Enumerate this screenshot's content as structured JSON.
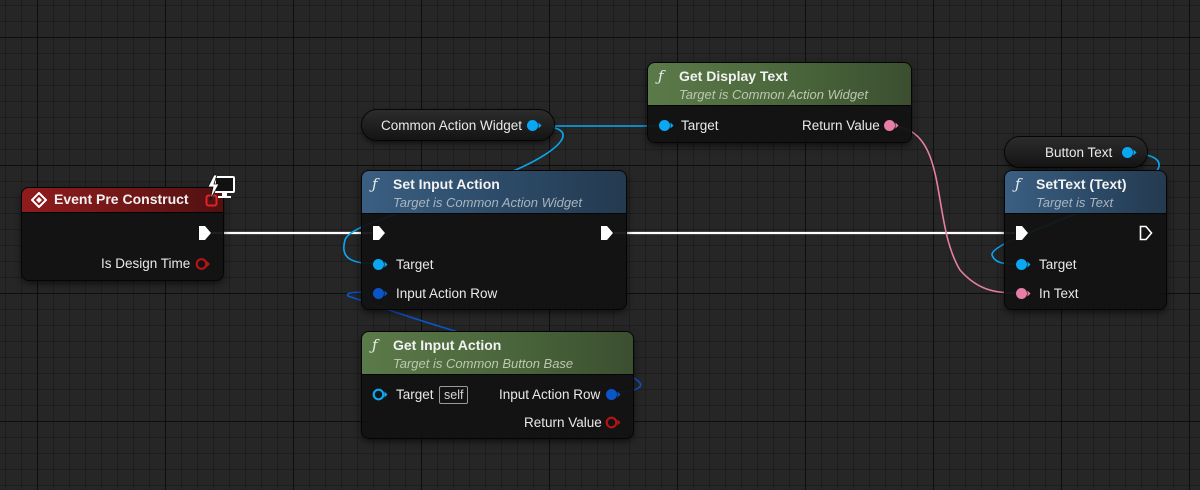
{
  "colors": {
    "exec_wire": "#ffffff",
    "object_pin": "#0aa8f2",
    "struct_pin": "#0a55c8",
    "text_pin": "#e77ea8",
    "bool_pin": "#951010",
    "function_header": "#3a5f82",
    "pure_function_header": "#5b7a49",
    "event_header": "#8f1c1c"
  },
  "event_node": {
    "title": "Event Pre Construct",
    "icon": "event-diamond-icon",
    "editor_only_icon": "monitor-lightning-icon",
    "pins": {
      "design_time": "Is Design Time"
    }
  },
  "variables": {
    "common_action_widget": "Common Action Widget",
    "button_text": "Button Text"
  },
  "set_input_action": {
    "fn_icon": "ƒ",
    "title": "Set Input Action",
    "subtitle": "Target is Common Action Widget",
    "pins": {
      "target": "Target",
      "input_action_row": "Input Action Row"
    }
  },
  "get_display_text": {
    "fn_icon": "ƒ",
    "title": "Get Display Text",
    "subtitle": "Target is Common Action Widget",
    "pins": {
      "target": "Target",
      "return_value": "Return Value"
    }
  },
  "get_input_action": {
    "fn_icon": "ƒ",
    "title": "Get Input Action",
    "subtitle": "Target is Common Button Base",
    "pins": {
      "target": "Target",
      "self": "self",
      "input_action_row": "Input Action Row",
      "return_value": "Return Value"
    }
  },
  "set_text": {
    "fn_icon": "ƒ",
    "title": "SetText (Text)",
    "subtitle": "Target is Text",
    "pins": {
      "target": "Target",
      "in_text": "In Text"
    }
  }
}
